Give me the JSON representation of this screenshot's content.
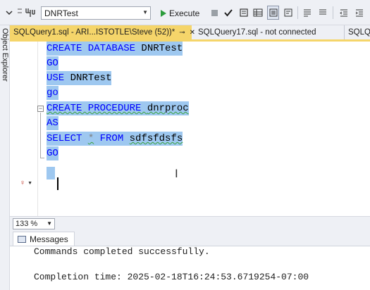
{
  "toolbar": {
    "database": "DNRTest",
    "execute_label": "Execute"
  },
  "sidebar": {
    "object_explorer_label": "Object Explorer"
  },
  "tabs": [
    {
      "label": "SQLQuery1.sql - ARI...ISTOTLE\\Steve (52))*",
      "active": true
    },
    {
      "label": "SQLQuery17.sql - not connected",
      "active": false
    },
    {
      "label": "SQLQ",
      "active": false
    }
  ],
  "editor": {
    "lines": [
      "CREATE DATABASE DNRTest",
      "GO",
      "USE DNRTest",
      "go",
      "CREATE PROCEDURE dnrproc",
      "AS",
      "SELECT * FROM sdfsfdsfs",
      "GO"
    ],
    "selection_color": "#9ec8f0",
    "keyword_color": "#0000ff"
  },
  "zoom": {
    "value": "133 %"
  },
  "messages": {
    "tab_label": "Messages",
    "lines": [
      "Commands completed successfully.",
      "Completion time: 2025-02-18T16:24:53.6719254-07:00"
    ]
  },
  "colors": {
    "active_tab": "#f5d56a",
    "chrome": "#eef0f5"
  }
}
